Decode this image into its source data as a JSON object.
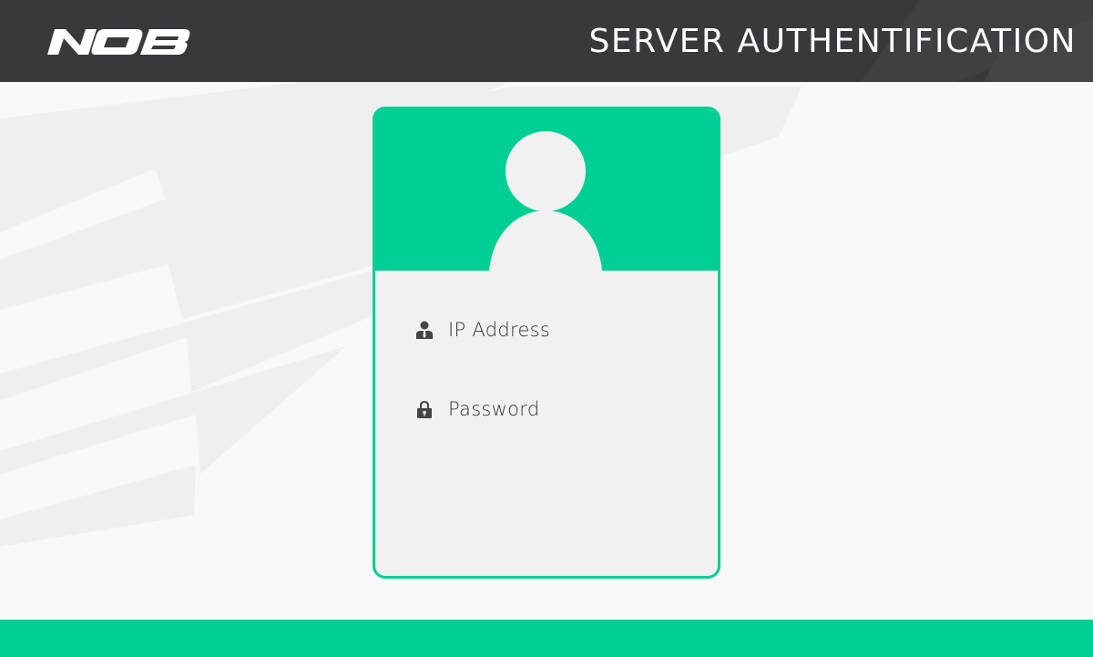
{
  "header": {
    "logo_text": "NOB",
    "title": "SERVER AUTHENTIFICATION"
  },
  "login": {
    "ip_field": {
      "placeholder": "IP Address",
      "icon": "user-icon"
    },
    "password_field": {
      "placeholder": "Password",
      "icon": "lock-icon"
    }
  },
  "colors": {
    "accent": "#00cf94",
    "header_bg": "#39393d",
    "page_bg": "#f8f8f8",
    "card_bg": "#f1f1f1"
  }
}
